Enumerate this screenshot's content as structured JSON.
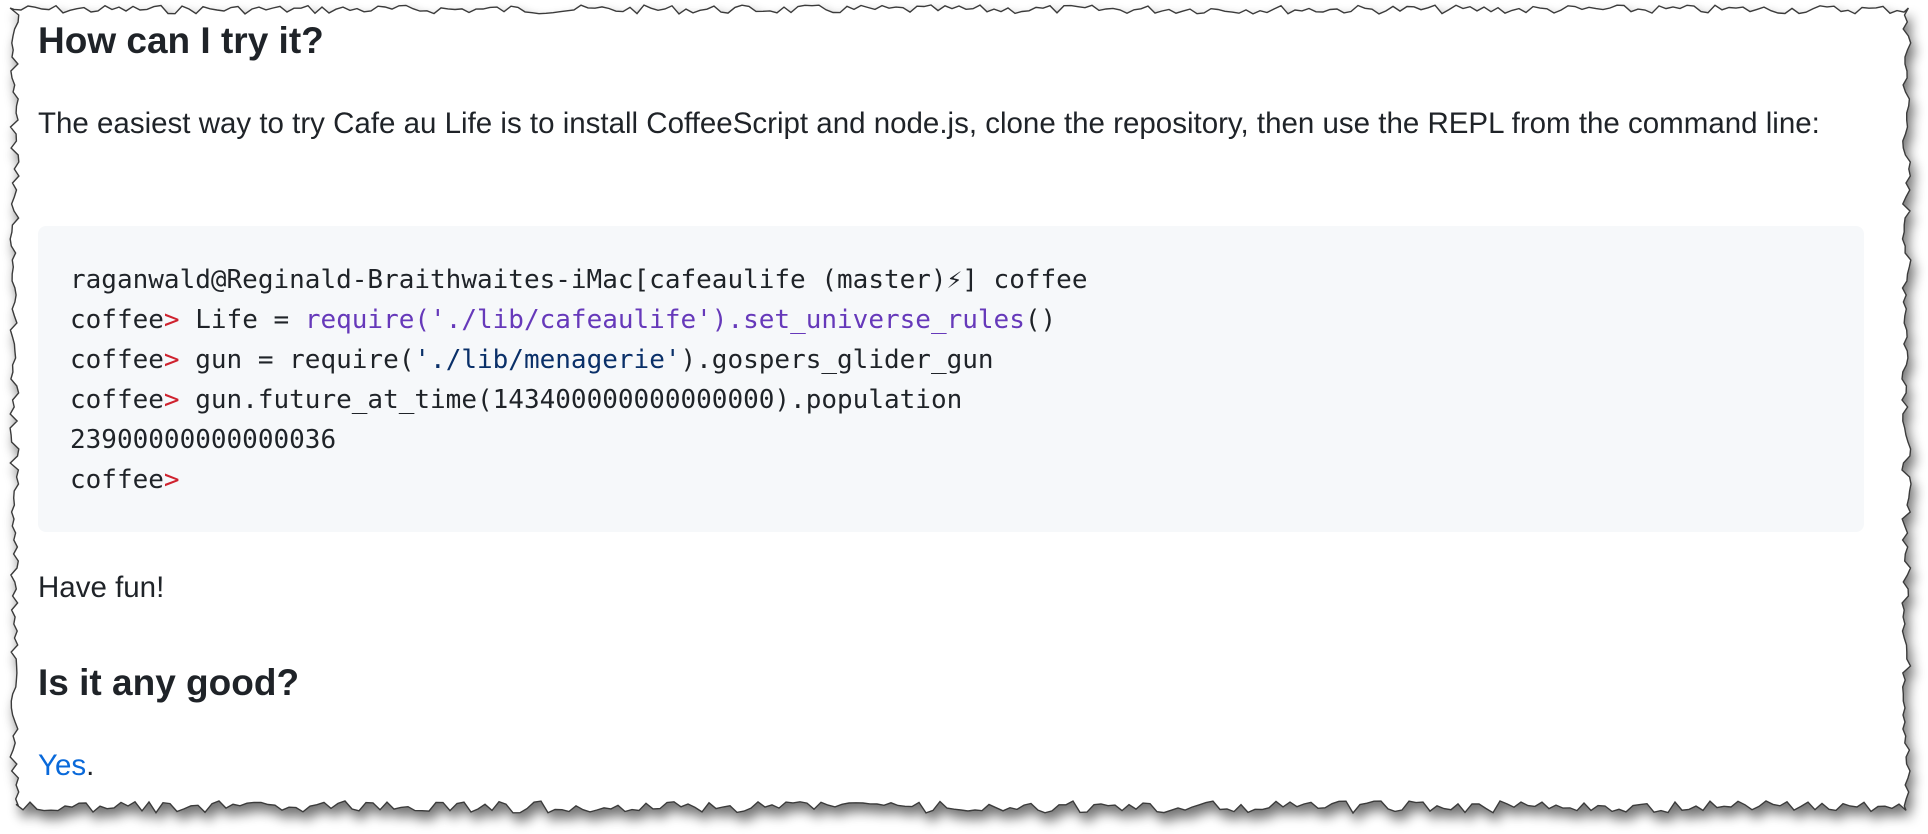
{
  "section1": {
    "heading": "How can I try it?",
    "intro": "The easiest way to try Cafe au Life is to install CoffeeScript and node.js, clone the repository, then use the REPL from the command line:"
  },
  "code": {
    "line1": "raganwald@Reginald-Braithwaites-iMac[cafeaulife (master)⚡] coffee",
    "prompt_word": "coffee",
    "prompt_mark": ">",
    "line2": {
      "prefix": " Life = ",
      "call": "require('./lib/cafeaulife').set_universe_rules",
      "suffix": "()"
    },
    "line3": {
      "prefix": " gun = require(",
      "string": "'./lib/menagerie'",
      "suffix": ").gospers_glider_gun"
    },
    "line4": " gun.future_at_time(143400000000000000).population",
    "line5": "23900000000000036"
  },
  "closing": "Have fun!",
  "section2": {
    "heading": "Is it any good?",
    "answer_link": "Yes",
    "answer_punct": "."
  }
}
